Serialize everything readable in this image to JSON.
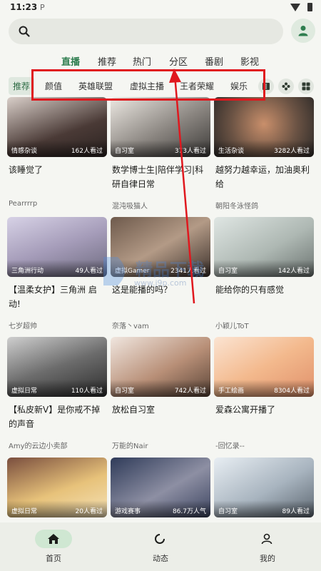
{
  "status": {
    "time": "11:23",
    "app_glyph": "P"
  },
  "header": {
    "search_placeholder": "",
    "user_icon": "person-icon"
  },
  "main_tabs": [
    {
      "label": "直播",
      "active": true
    },
    {
      "label": "推荐"
    },
    {
      "label": "热门"
    },
    {
      "label": "分区"
    },
    {
      "label": "番剧"
    },
    {
      "label": "影视"
    }
  ],
  "sub_tabs": [
    "推荐",
    "颜值",
    "英雄联盟",
    "虚拟主播",
    "王者荣耀",
    "娱乐"
  ],
  "sub_icons": [
    "book-icon",
    "gamepad-icon",
    "grid-icon"
  ],
  "annotation_color": "#e0181e",
  "cards": [
    {
      "category": "情感杂谈",
      "views": "162人看过",
      "title": "该睡觉了",
      "streamer": "Pearrrrp"
    },
    {
      "category": "自习室",
      "views": "373人看过",
      "title": "数学博士生|陪伴学习|科研自律日常",
      "streamer": "混沌吸猫人"
    },
    {
      "category": "生活杂谈",
      "views": "3282人看过",
      "title": "越努力越幸运，加油奥利给",
      "streamer": "朝阳冬泳怪鸽"
    },
    {
      "category": "三角洲行动",
      "views": "49人看过",
      "title": "【温柔女护】三角洲 启动!",
      "streamer": "七岁超帅"
    },
    {
      "category": "虚拟Gamer",
      "views": "2341人看过",
      "title": "这是能播的吗？",
      "streamer": "奈落丶vam"
    },
    {
      "category": "自习室",
      "views": "142人看过",
      "title": "能给你的只有感觉",
      "streamer": "小颖儿ToT"
    },
    {
      "category": "虚拟日常",
      "views": "110人看过",
      "title": "【私皮新V】是你戒不掉的声音",
      "streamer": "Amy的云边小卖部"
    },
    {
      "category": "自习室",
      "views": "742人看过",
      "title": "放松自习室",
      "streamer": "万能的Nair"
    },
    {
      "category": "手工绘画",
      "views": "8304人看过",
      "title": "爱森公寓开播了",
      "streamer": "-回忆录--"
    },
    {
      "category": "虚拟日常",
      "views": "20人看过",
      "title": "",
      "streamer": ""
    },
    {
      "category": "游戏赛事",
      "views": "86.7万人气",
      "title": "",
      "streamer": ""
    },
    {
      "category": "自习室",
      "views": "89人看过",
      "title": "",
      "streamer": ""
    }
  ],
  "bottom_nav": [
    {
      "label": "首页",
      "icon": "home-icon",
      "active": true
    },
    {
      "label": "动态",
      "icon": "refresh-icon"
    },
    {
      "label": "我的",
      "icon": "person-icon"
    }
  ],
  "watermark": {
    "text": "www.j9p.com"
  }
}
